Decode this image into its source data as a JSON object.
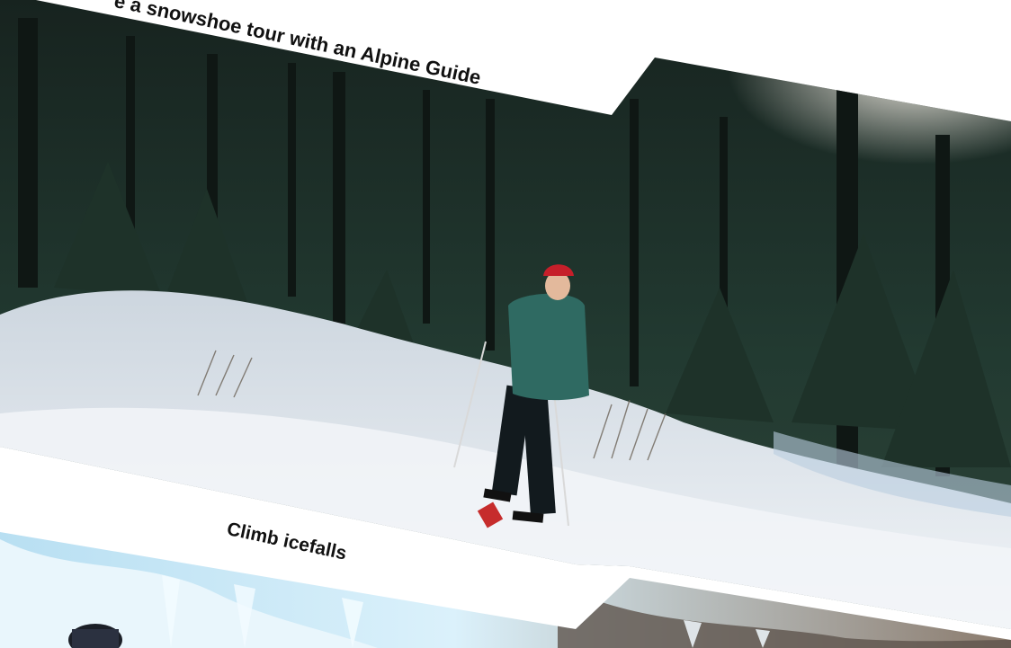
{
  "captions": {
    "snowshoe": "e a snowshoe tour with an Alpine Guide",
    "icefalls": "Climb icefalls"
  },
  "palette": {
    "page_bg": "#ffffff",
    "forest_dark": "#1b2a25",
    "snow": "#e9eef3",
    "sky_glow": "#f4efe6",
    "ice_blue": "#cfeaf7",
    "jacket": "#2f6a62",
    "hat": "#c61f2a",
    "text": "#111111"
  }
}
